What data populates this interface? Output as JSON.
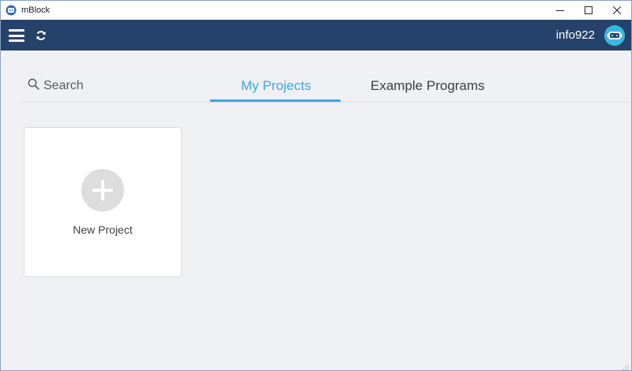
{
  "window": {
    "title": "mBlock",
    "app_icon": "mblock-logo-icon",
    "controls": [
      "minimize-icon",
      "maximize-icon",
      "close-icon"
    ]
  },
  "header": {
    "menu_icon": "hamburger-menu-icon",
    "sync_icon": "refresh-icon",
    "username": "info922",
    "avatar_icon": "robot-avatar-icon",
    "background_color": "#25426a"
  },
  "toolbar": {
    "search_placeholder": "Search",
    "tabs": [
      {
        "label": "My Projects",
        "active": true
      },
      {
        "label": "Example Programs",
        "active": false
      }
    ],
    "accent_color": "#3aa7e4"
  },
  "projects": {
    "new_project_label": "New Project"
  }
}
